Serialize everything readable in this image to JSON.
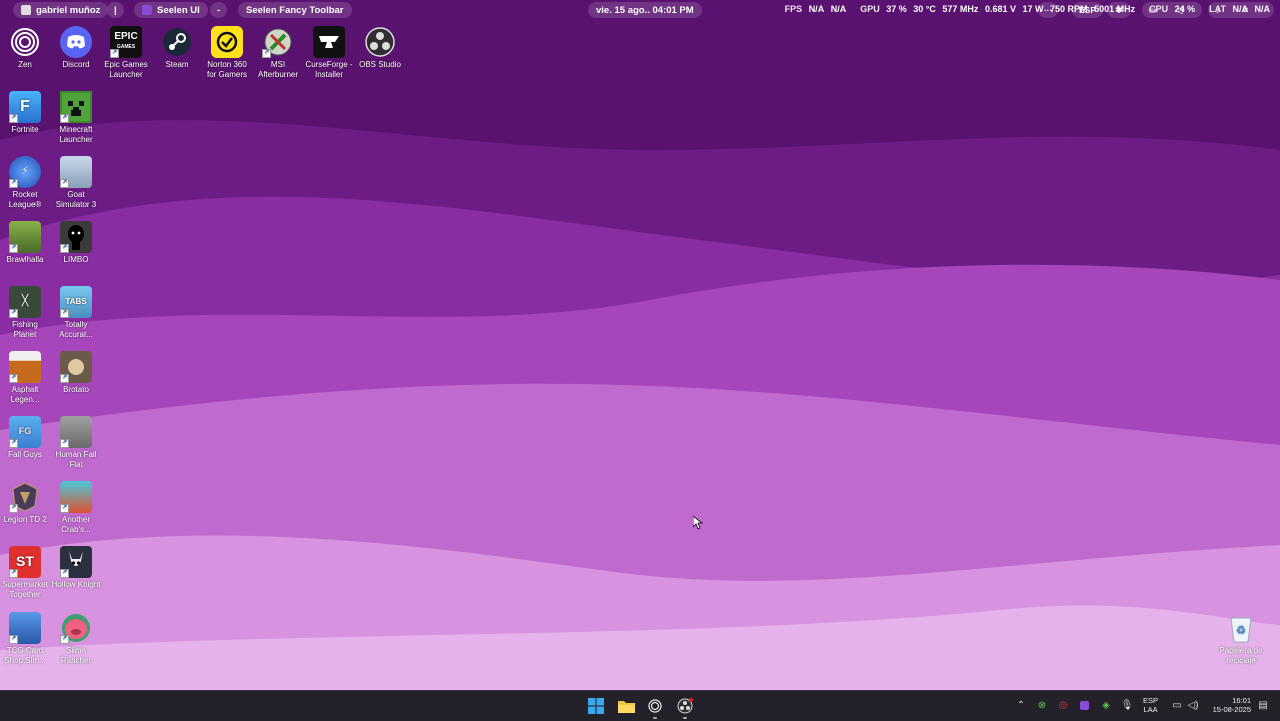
{
  "topbar": {
    "user": "gabriel muñoz",
    "separator": "|",
    "seelen_ui": "Seelen UI",
    "dash": "-",
    "toolbar_name": "Seelen Fancy Toolbar",
    "datetime": "vie. 15 ago.. 04:01 PM",
    "more": "···",
    "esp": "ESP",
    "stats": {
      "fps_label": "FPS",
      "fps_values": [
        "N/A",
        "N/A"
      ],
      "gpu_label": "GPU",
      "gpu_values": [
        "37 %",
        "30 °C",
        "577 MHz",
        "0.681 V",
        "17 W",
        "750 RPM",
        "5001 MHz"
      ],
      "cpu_label": "CPU",
      "cpu_values": [
        "24 %"
      ],
      "lat_label": "LAT",
      "lat_values": [
        "N/A",
        "N/A"
      ]
    }
  },
  "desktop_icons": [
    {
      "label": "Zen",
      "icon": "zen-icon",
      "color": "#111111"
    },
    {
      "label": "Discord",
      "icon": "discord-icon",
      "color": "#5865f2"
    },
    {
      "label": "Epic Games Launcher",
      "icon": "epic-games-icon",
      "color": "#111111"
    },
    {
      "label": "Steam",
      "icon": "steam-icon",
      "color": "#1b2838"
    },
    {
      "label": "Norton 360 for Gamers",
      "icon": "norton-icon",
      "color": "#ffe01b"
    },
    {
      "label": "MSI Afterburner",
      "icon": "msi-afterburner-icon",
      "color": "#3a7d3a"
    },
    {
      "label": "CurseForge - Installer",
      "icon": "curseforge-icon",
      "color": "#111111"
    },
    {
      "label": "OBS Studio",
      "icon": "obs-icon",
      "color": "#222222"
    },
    {
      "label": "Fortnite",
      "icon": "fortnite-icon",
      "color": "#3aa0f0"
    },
    {
      "label": "Minecraft Launcher",
      "icon": "minecraft-icon",
      "color": "#3c8b2f"
    },
    {
      "label": "Rocket League®",
      "icon": "rocket-league-icon",
      "color": "#2a64c8"
    },
    {
      "label": "Goat Simulator 3",
      "icon": "goat-simulator-icon",
      "color": "#9ab0c8"
    },
    {
      "label": "Brawlhalla",
      "icon": "brawlhalla-icon",
      "color": "#6a8a3a"
    },
    {
      "label": "LIMBO",
      "icon": "limbo-icon",
      "color": "#2a2a2a"
    },
    {
      "label": "Fishing Planet",
      "icon": "fishing-planet-icon",
      "color": "#3a4a3a"
    },
    {
      "label": "Totally Accurat...",
      "icon": "tabs-icon",
      "color": "#6ab4d8"
    },
    {
      "label": "Asphalt Legen...",
      "icon": "asphalt-icon",
      "color": "#c86a1e"
    },
    {
      "label": "Brotato",
      "icon": "brotato-icon",
      "color": "#5a4a3a"
    },
    {
      "label": "Fall Guys",
      "icon": "fall-guys-icon",
      "color": "#4aa0e0"
    },
    {
      "label": "Human Fall Flat",
      "icon": "human-fall-flat-icon",
      "color": "#8a8a8a"
    },
    {
      "label": "Legion TD 2",
      "icon": "legion-td-icon",
      "color": "#4a3a5a"
    },
    {
      "label": "Another Crab's...",
      "icon": "another-crab-icon",
      "color": "#3ab0c0"
    },
    {
      "label": "Supermarket Together",
      "icon": "supermarket-together-icon",
      "color": "#e03030"
    },
    {
      "label": "Hollow Knight",
      "icon": "hollow-knight-icon",
      "color": "#2a3040"
    },
    {
      "label": "TCG Card Shop Sim...",
      "icon": "tcg-card-shop-icon",
      "color": "#3a78c8"
    },
    {
      "label": "Slime Rancher",
      "icon": "slime-rancher-icon",
      "color": "#e0506a"
    }
  ],
  "recycle_bin": {
    "label": "Papelera de reciclaje",
    "icon": "recycle-bin-icon"
  },
  "taskbar": {
    "lang_top": "ESP",
    "lang_bottom": "LAA",
    "time": "16:01",
    "date": "15-08-2025",
    "apps": [
      "windows-start-icon",
      "file-explorer-icon",
      "zen-icon",
      "obs-icon"
    ]
  }
}
